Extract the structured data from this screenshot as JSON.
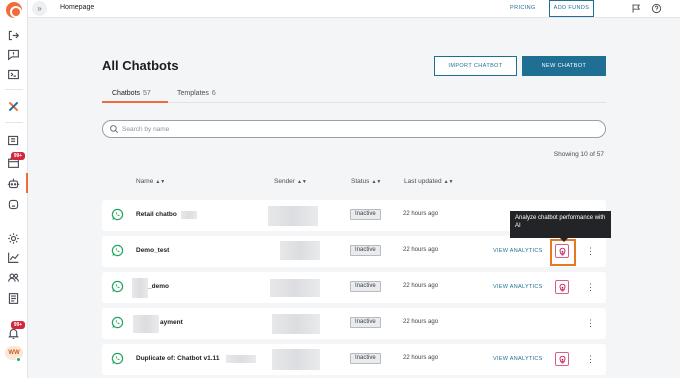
{
  "topbar": {
    "breadcrumb": "Homepage",
    "pricing": "PRICING",
    "add_funds": "ADD FUNDS",
    "icons": [
      "expand-icon",
      "flag-icon",
      "help-icon"
    ]
  },
  "sidebar": {
    "icons": [
      "logo-icon",
      "exit-icon",
      "chat-icon",
      "terminal-icon",
      "x-icon",
      "campaign-icon",
      "calendar-icon",
      "bot-icon",
      "robot-icon",
      "settings-icon",
      "chart-icon",
      "users-icon",
      "document-icon",
      "bell-icon"
    ],
    "badges": [
      "99+",
      "99+"
    ],
    "avatar": "WW"
  },
  "page": {
    "title": "All Chatbots",
    "import_button": "IMPORT CHATBOT",
    "new_button": "NEW CHATBOT"
  },
  "tabs": [
    {
      "label": "Chatbots",
      "count": "57"
    },
    {
      "label": "Templates",
      "count": "6"
    }
  ],
  "search": {
    "placeholder": "Search by name",
    "value": ""
  },
  "showing": "Showing 10 of 57",
  "columns": {
    "name": "Name",
    "sender": "Sender",
    "status": "Status",
    "last_updated": "Last updated"
  },
  "rows": [
    {
      "name": "Retail chatbo",
      "status": "Inactive",
      "updated": "22 hours ago",
      "analytics": ""
    },
    {
      "name": "Demo_test",
      "status": "Inactive",
      "updated": "22 hours ago",
      "analytics": "VIEW ANALYTICS"
    },
    {
      "name": "_demo",
      "status": "Inactive",
      "updated": "22 hours ago",
      "analytics": "VIEW ANALYTICS"
    },
    {
      "name": "ayment",
      "status": "Inactive",
      "updated": "22 hours ago",
      "analytics": ""
    },
    {
      "name": "Duplicate of: Chatbot v1.11",
      "status": "Inactive",
      "updated": "22 hours ago",
      "analytics": "VIEW ANALYTICS"
    }
  ],
  "tooltip": {
    "text": "Analyze chatbot performance with AI"
  },
  "colors": {
    "accent": "#1f6f95",
    "brand": "#f26b3a",
    "whatsapp": "#25a55f",
    "ai": "#c2185b",
    "highlight": "#e87722"
  }
}
